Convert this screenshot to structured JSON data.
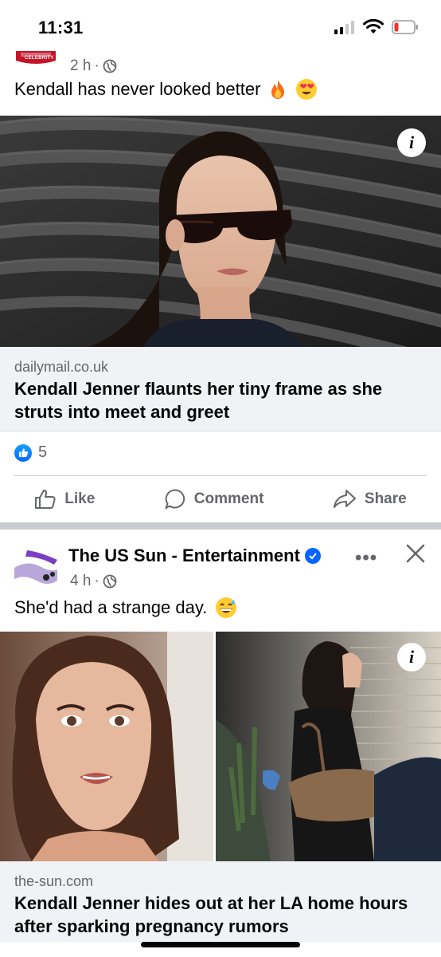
{
  "status_bar": {
    "time": "11:31"
  },
  "post1": {
    "page_logo_text": "CELEBRITY",
    "time_ago": "2 h",
    "caption": "Kendall has never looked better",
    "link": {
      "domain": "dailymail.co.uk",
      "title": "Kendall Jenner flaunts her tiny frame as she struts into meet and greet"
    },
    "reaction_count": "5",
    "actions": {
      "like": "Like",
      "comment": "Comment",
      "share": "Share"
    }
  },
  "post2": {
    "page_name": "The US Sun - Entertainment",
    "time_ago": "4 h",
    "caption": "She'd had a strange day.",
    "link": {
      "domain": "the-sun.com",
      "title": "Kendall Jenner hides out at her LA home hours after sparking pregnancy rumors"
    }
  },
  "colors": {
    "facebook_blue": "#0866ff",
    "secondary_text": "#65676b",
    "link_box_bg": "#f0f2f5"
  }
}
